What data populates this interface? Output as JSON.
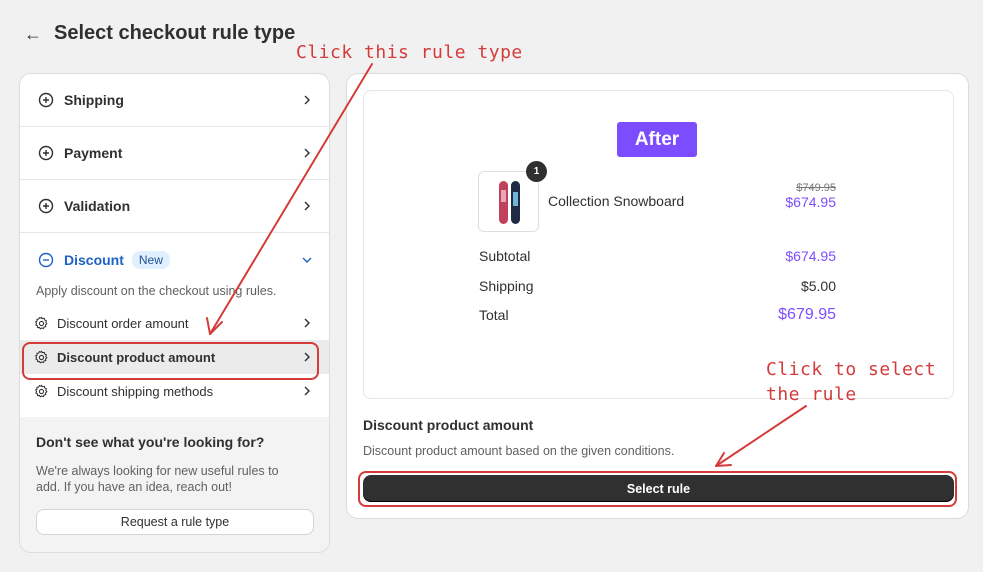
{
  "header": {
    "back_icon": "arrow-left-icon",
    "title": "Select checkout rule type"
  },
  "categories": [
    {
      "label": "Shipping",
      "icon": "plus-circle-icon"
    },
    {
      "label": "Payment",
      "icon": "plus-circle-icon"
    },
    {
      "label": "Validation",
      "icon": "plus-circle-icon"
    }
  ],
  "discount": {
    "label": "Discount",
    "badge": "New",
    "description": "Apply discount on the checkout using rules.",
    "items": [
      {
        "label": "Discount order amount",
        "icon": "gear-icon"
      },
      {
        "label": "Discount product amount",
        "icon": "gear-icon"
      },
      {
        "label": "Discount shipping methods",
        "icon": "gear-icon"
      }
    ]
  },
  "help": {
    "title": "Don't see what you're looking for?",
    "text": "We're always looking for new useful rules to add. If you have an idea, reach out!",
    "button": "Request a rule type"
  },
  "preview": {
    "badge": "After",
    "quantity": "1",
    "product_name": "Collection Snowboard",
    "price_old": "$749.95",
    "price_new": "$674.95",
    "subtotal_label": "Subtotal",
    "subtotal_value": "$674.95",
    "shipping_label": "Shipping",
    "shipping_value": "$5.00",
    "total_label": "Total",
    "total_value": "$679.95"
  },
  "rule": {
    "title": "Discount product amount",
    "description": "Discount product amount based on the given conditions.",
    "select_button": "Select rule"
  },
  "annotations": {
    "note_1": "Click this rule type",
    "note_2_line1": "Click to select",
    "note_2_line2": "the rule"
  },
  "colors": {
    "accent_purple": "#7c4dff",
    "discount_blue": "#1d62c6",
    "annotation_red": "#d43b3b"
  }
}
